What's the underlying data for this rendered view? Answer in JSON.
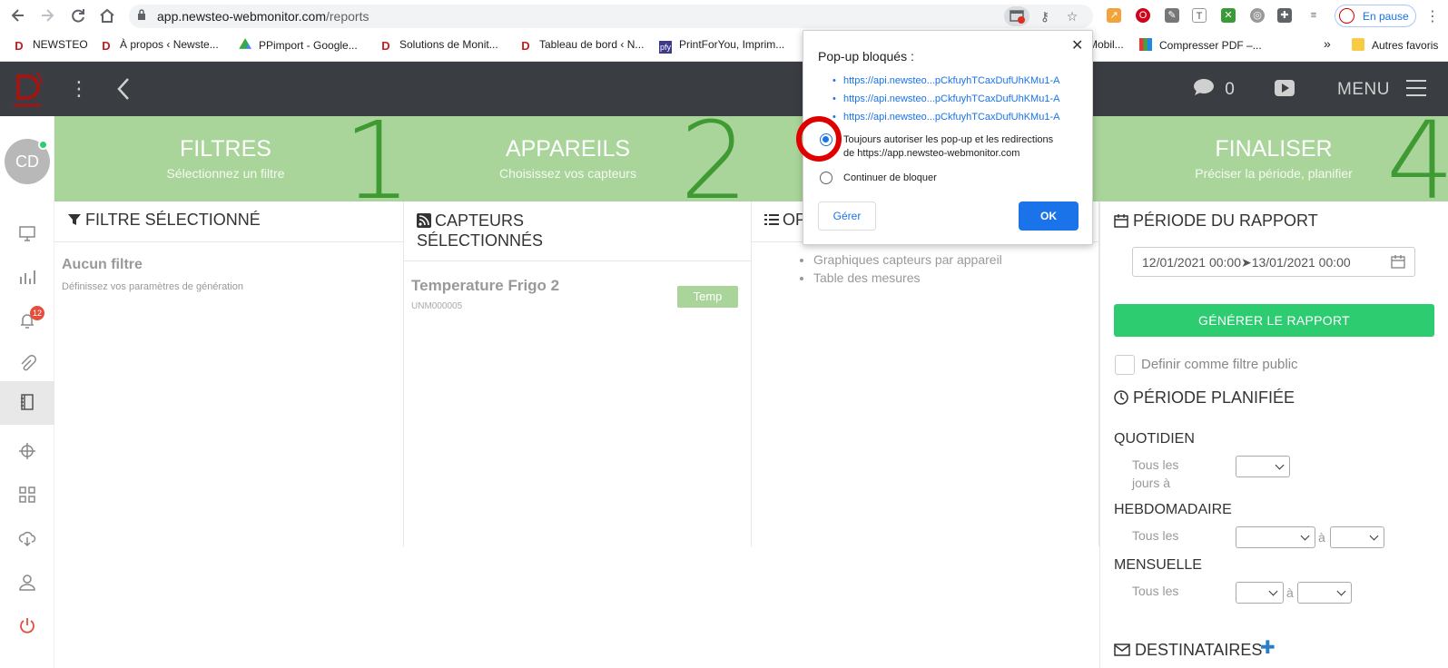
{
  "browser": {
    "url_host": "app.newsteo-webmonitor.com",
    "url_path": "/reports",
    "profile_label": "En pause",
    "bookmarks": [
      {
        "label": "NEWSTEO",
        "icon": "d-logo-icon"
      },
      {
        "label": "À propos ‹ Newste...",
        "icon": "d-logo-icon"
      },
      {
        "label": "PPimport - Google...",
        "icon": "google-drive-icon"
      },
      {
        "label": "Solutions de Monit...",
        "icon": "d-logo-icon"
      },
      {
        "label": "Tableau de bord ‹ N...",
        "icon": "d-logo-icon"
      },
      {
        "label": "PrintForYou, Imprim...",
        "icon": "pfy-icon"
      },
      {
        "label": "Mobil...",
        "icon": ""
      },
      {
        "label": "Compresser PDF –...",
        "icon": "colorful-grid-icon"
      },
      {
        "label": "»",
        "icon": ""
      },
      {
        "label": "Autres favoris",
        "icon": "folder-icon"
      }
    ]
  },
  "popup": {
    "title": "Pop-up bloqués :",
    "links": [
      "https://api.newsteo...pCkfuyhTCaxDufUhKMu1-A",
      "https://api.newsteo...pCkfuyhTCaxDufUhKMu1-A",
      "https://api.newsteo...pCkfuyhTCaxDufUhKMu1-A"
    ],
    "option_allow_line1": "Toujours autoriser les pop-up et les redirections",
    "option_allow_line2": "de https://app.newsteo-webmonitor.com",
    "option_block": "Continuer de bloquer",
    "manage_label": "Gérer",
    "ok_label": "OK"
  },
  "header": {
    "chat_count": "0",
    "menu_label": "MENU"
  },
  "sidebar": {
    "avatar_initials": "CD",
    "notification_count": "12"
  },
  "steps": [
    {
      "title": "FILTRES",
      "subtitle": "Sélectionnez un filtre",
      "number": "1"
    },
    {
      "title": "APPAREILS",
      "subtitle": "Choisissez vos capteurs",
      "number": "2"
    },
    {
      "title": "FINALISER",
      "subtitle": "Préciser la période, planifier",
      "number": "4"
    }
  ],
  "filter_panel": {
    "heading": "FILTRE SÉLECTIONNÉ",
    "empty_title": "Aucun filtre",
    "empty_sub": "Définissez vos paramètres de génération"
  },
  "sensors_panel": {
    "heading_line1": "CAPTEURS",
    "heading_line2": "SÉLECTIONNÉS",
    "sensor_name": "Temperature Frigo 2",
    "sensor_id": "UNM000005",
    "sensor_tag": "Temp"
  },
  "options_panel": {
    "heading": "OP",
    "items": [
      "Graphiques capteurs par appareil",
      "Table des mesures"
    ]
  },
  "report": {
    "period_heading": "PÉRIODE DU RAPPORT",
    "date_range": "12/01/2021 00:00➤13/01/2021 00:00",
    "generate_label": "GÉNÉRER LE RAPPORT",
    "public_filter_label": "Definir comme filtre public",
    "planned_heading": "PÉRIODE PLANIFIÉE",
    "daily_label": "QUOTIDIEN",
    "daily_text_1": "Tous les",
    "daily_text_2": "jours à",
    "weekly_label": "HEBDOMADAIRE",
    "weekly_text": "Tous les",
    "monthly_label": "MENSUELLE",
    "monthly_text": "Tous les",
    "at_label": "à",
    "recipients_heading": "DESTINATAIRES"
  },
  "colors": {
    "accent_green": "#a9d59a",
    "step_number": "#3f9a33",
    "generate_green": "#2ecc71",
    "header_dark": "#3a3d42",
    "link_blue": "#1a73e8",
    "highlight_red": "#e00000"
  }
}
